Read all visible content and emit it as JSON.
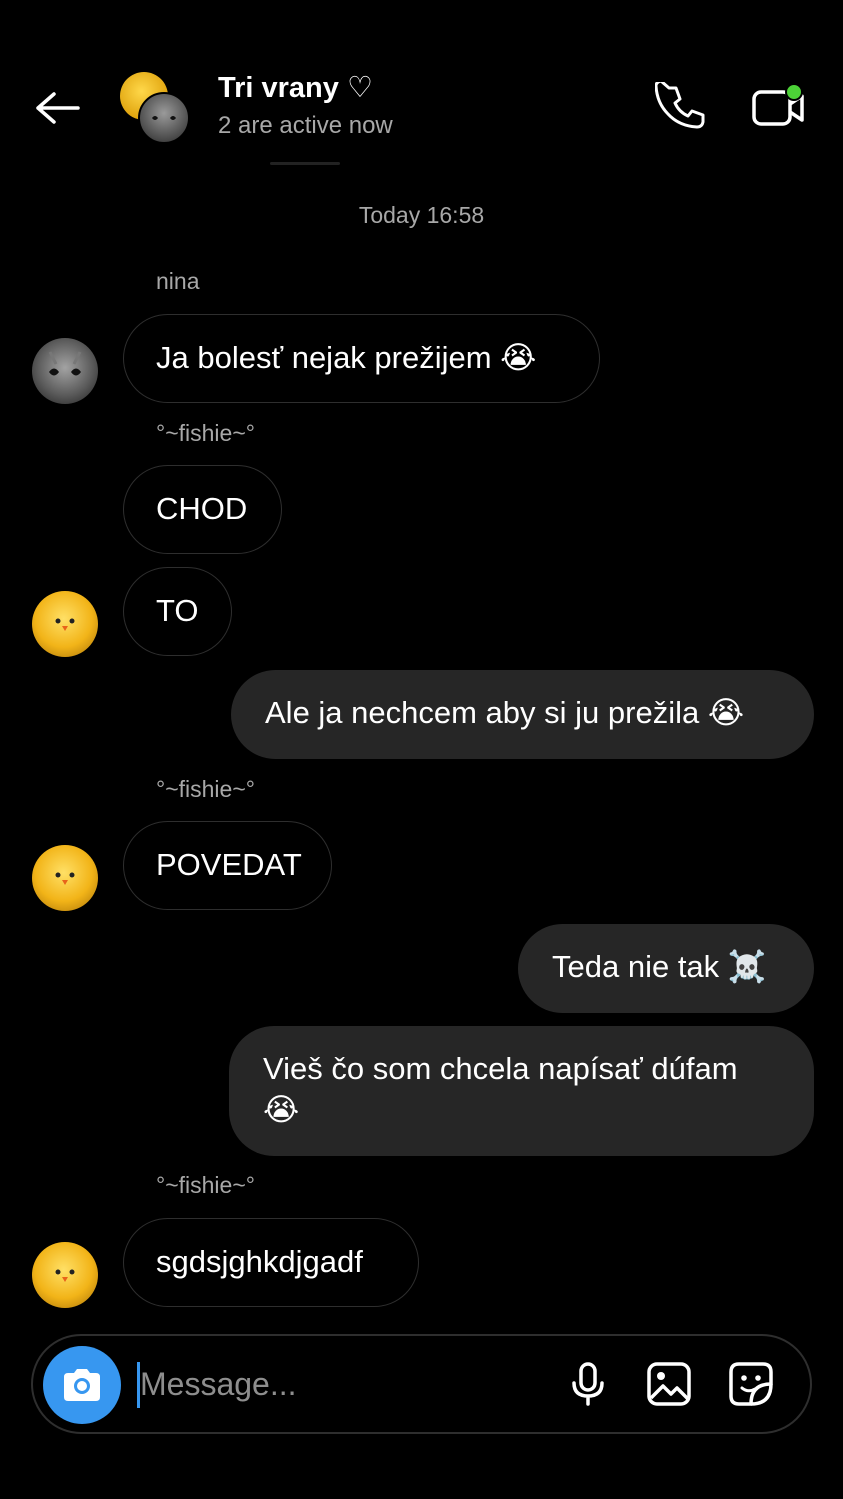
{
  "header": {
    "title": "Tri vrany ♡",
    "subtitle": "2 are active now",
    "accent_online": "#4cd137"
  },
  "thread": {
    "timestamp": "Today 16:58",
    "senders": [
      "nina",
      "°~fishie~°",
      "°~fishie~°",
      "°~fishie~°"
    ],
    "messages": [
      {
        "from": "nina",
        "text": "Ja bolesť nejak prežijem 😭"
      },
      {
        "from": "°~fishie~°",
        "text": "CHOD"
      },
      {
        "from": "°~fishie~°",
        "text": "TO"
      },
      {
        "from": "me",
        "text": "Ale ja nechcem aby si ju prežila 😭"
      },
      {
        "from": "°~fishie~°",
        "text": "POVEDAT"
      },
      {
        "from": "me",
        "text": "Teda nie tak ☠️"
      },
      {
        "from": "me",
        "text_line1": "Vieš čo som chcela napísať dúfam",
        "text_line2": "😭"
      },
      {
        "from": "°~fishie~°",
        "text": "sgdsjghkdjgadf"
      }
    ]
  },
  "composer": {
    "placeholder": "Message...",
    "camera_color": "#3797f0",
    "icons": [
      "camera-icon",
      "microphone-icon",
      "gallery-icon",
      "sticker-icon"
    ]
  }
}
